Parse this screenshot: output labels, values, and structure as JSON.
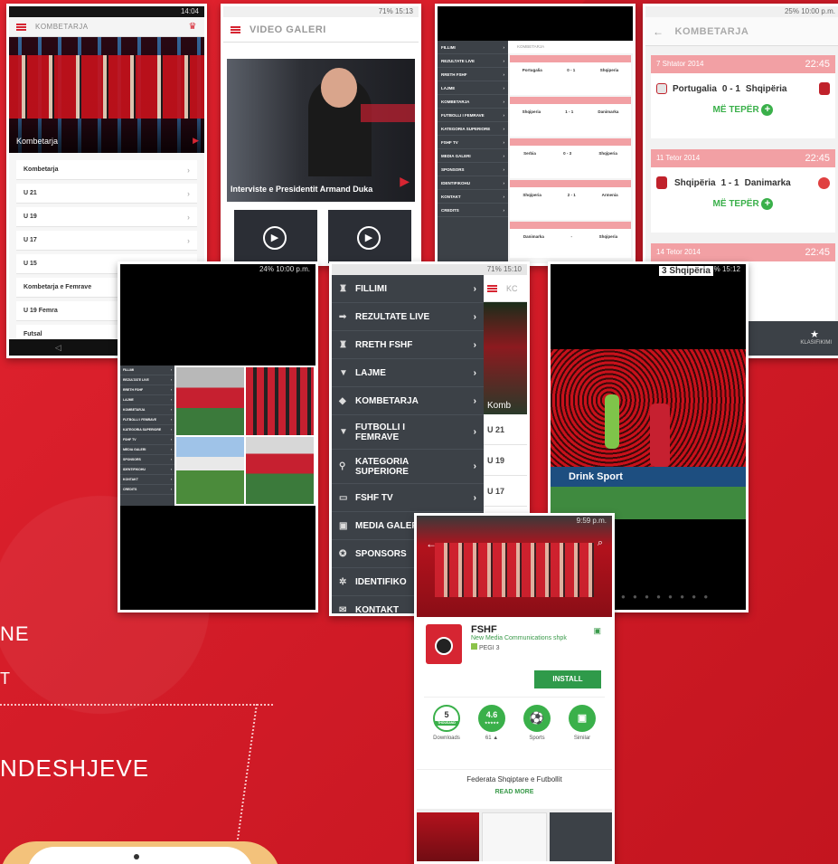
{
  "screen1": {
    "status_time": "14:04",
    "title": "KOMBETARJA",
    "hero_caption": "Kombetarja",
    "items": [
      "Kombetarja",
      "U 21",
      "U 19",
      "U 17",
      "U 15",
      "Kombetarja e Femrave",
      "U 19 Femra",
      "Futsal"
    ]
  },
  "screen2": {
    "status": "71% 15:13",
    "title": "VIDEO GALERI",
    "caption": "Interviste e Presidentit Armand Duka"
  },
  "screen3": {
    "menu": [
      "FILLIMI",
      "REZULTATE LIVE",
      "RRETH FSHF",
      "LAJME",
      "KOMBETARJA",
      "FUTBOLLI I FEMRAVE",
      "KATEGORIA SUPERIORE",
      "FSHF TV",
      "MEDIA GALERI",
      "SPONSORS",
      "IDENTIFIKOHU",
      "KONTAKT",
      "CREDITS"
    ],
    "header": "KOMBETARJA",
    "matches": [
      {
        "home": "Portugalia",
        "score": "0 - 1",
        "away": "Shqiperia"
      },
      {
        "home": "Shqiperia",
        "score": "1 - 1",
        "away": "Danimarka"
      },
      {
        "home": "Serbia",
        "score": "0 - 3",
        "away": "Shqiperia"
      },
      {
        "home": "Shqiperia",
        "score": "2 - 1",
        "away": "Armenia"
      },
      {
        "home": "Danimarka",
        "score": "-",
        "away": "Shqiperia"
      }
    ]
  },
  "screen4": {
    "status": "25% 10:00 p.m.",
    "title": "KOMBETARJA",
    "matches": [
      {
        "date": "7 Shtator 2014",
        "time": "22:45",
        "home": "Portugalia",
        "score": "0 - 1",
        "away": "Shqipëria"
      },
      {
        "date": "11 Tetor 2014",
        "time": "22:45",
        "home": "Shqipëria",
        "score": "1 - 1",
        "away": "Danimarka"
      },
      {
        "date": "14 Tetor 2014",
        "time": "22:45",
        "home": "",
        "score": "3",
        "away": "Shqipëria"
      }
    ],
    "more_label": "MË TEPËR",
    "bottom_right": "KLASIFIKIMI"
  },
  "screen5": {
    "status": "24% 10:00 p.m."
  },
  "screen6": {
    "status": "71% 15:10",
    "header_right": "KC",
    "menu": [
      {
        "label": "FILLIMI",
        "icon": "trophy-icon"
      },
      {
        "label": "REZULTATE LIVE",
        "icon": "shoe-icon"
      },
      {
        "label": "RRETH FSHF",
        "icon": "trophy-icon"
      },
      {
        "label": "LAJME",
        "icon": "shirt-icon"
      },
      {
        "label": "KOMBETARJA",
        "icon": "diamond-icon"
      },
      {
        "label": "FUTBOLLI I FEMRAVE",
        "icon": "shirt-icon"
      },
      {
        "label": "KATEGORIA SUPERIORE",
        "icon": "whistle-icon"
      },
      {
        "label": "FSHF TV",
        "icon": "tv-icon"
      },
      {
        "label": "MEDIA GALERI",
        "icon": "image-icon"
      },
      {
        "label": "SPONSORS",
        "icon": "star-icon"
      },
      {
        "label": "IDENTIFIKO",
        "icon": "gear-icon"
      },
      {
        "label": "KONTAKT",
        "icon": "contact-icon"
      }
    ],
    "side_items": [
      "Komb",
      "U 21",
      "U 19",
      "U 17"
    ]
  },
  "screen7": {
    "status": "71% 15:12",
    "peek_text": "3 Shqipëria",
    "banner": "Drink Sport"
  },
  "screen8": {
    "status": "9:59 p.m.",
    "app_name": "FSHF",
    "developer": "New Media Communications shpk",
    "rating_label": "PEGI 3",
    "install": "INSTALL",
    "stats": [
      {
        "value": "5",
        "sub": "THOUSAND",
        "label": "Downloads"
      },
      {
        "value": "4.6",
        "sub": "★★★★★",
        "label": "61 ▲"
      },
      {
        "value": "⚽",
        "sub": "",
        "label": "Sports"
      },
      {
        "value": "▣",
        "sub": "",
        "label": "Similar"
      }
    ],
    "description": "Federata Shqiptare e Futbollit",
    "read_more": "READ MORE"
  },
  "background_text": {
    "line1": "NE",
    "line2": "T",
    "line3": "NDESHJEVE"
  },
  "colors": {
    "brand_red": "#d91e2a",
    "green": "#3ab04a",
    "menu_dark": "#3c4147"
  }
}
